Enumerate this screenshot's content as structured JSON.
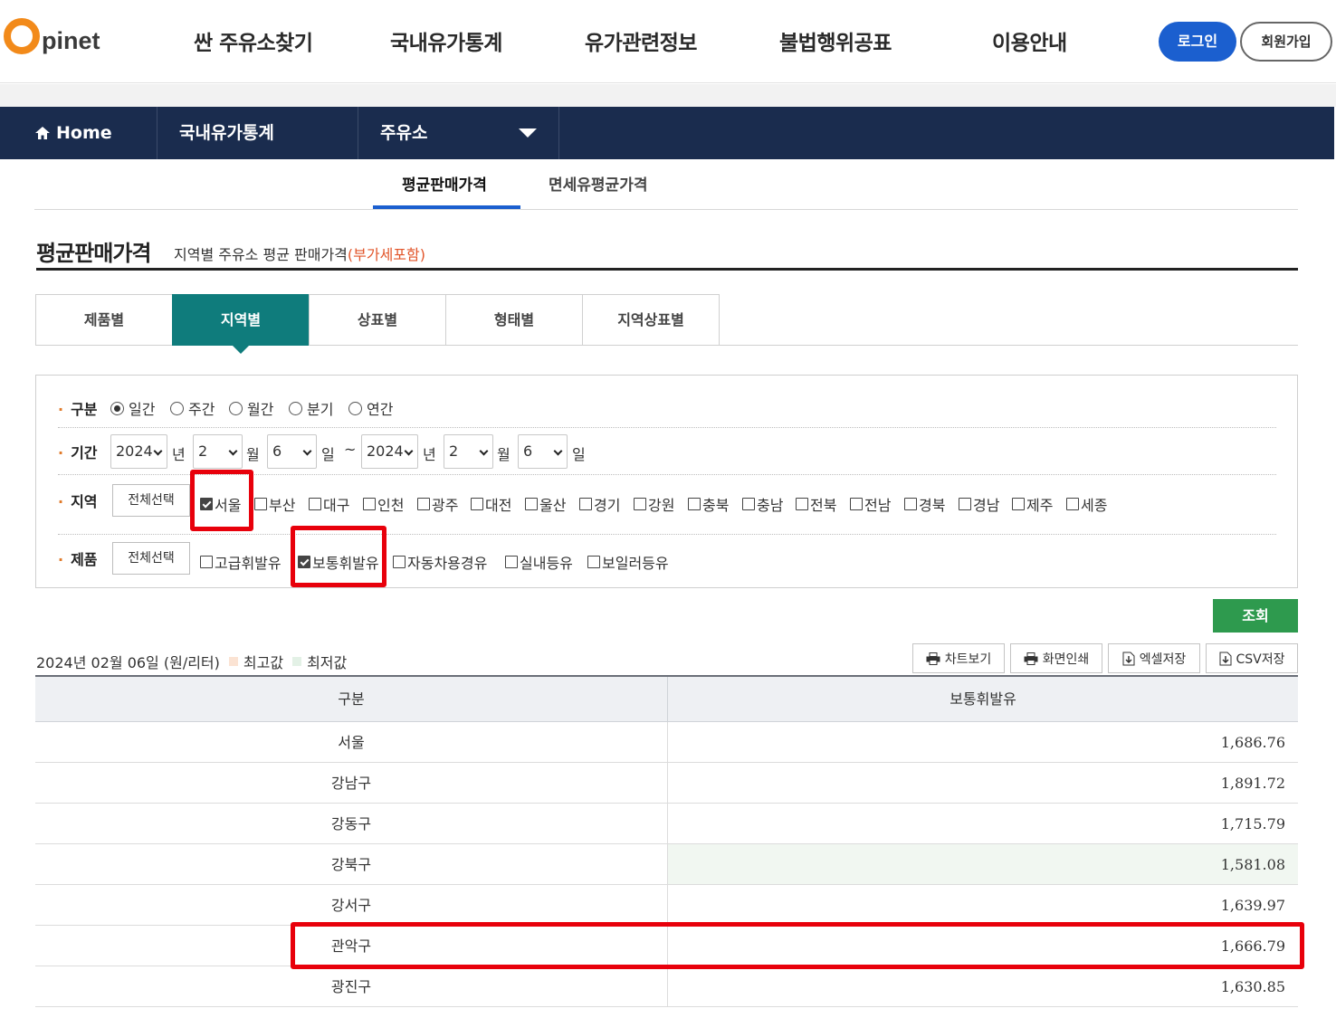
{
  "header": {
    "logo_o": "O",
    "logo_text": "pinet",
    "nav": [
      "싼 주유소찾기",
      "국내유가통계",
      "유가관련정보",
      "불법행위공표",
      "이용안내"
    ],
    "login": "로그인",
    "join": "회원가입"
  },
  "breadcrumb": {
    "home": "Home",
    "section": "국내유가통계",
    "current": "주유소"
  },
  "subtabs": [
    "평균판매가격",
    "면세유평균가격"
  ],
  "page": {
    "title": "평균판매가격",
    "subtitle": "지역별 주유소 평균 판매가격",
    "vat": "(부가세포함)"
  },
  "category_tabs": [
    "제품별",
    "지역별",
    "상표별",
    "형태별",
    "지역상표별"
  ],
  "filter": {
    "type_label": "구분",
    "types": [
      {
        "label": "일간",
        "checked": true
      },
      {
        "label": "주간",
        "checked": false
      },
      {
        "label": "월간",
        "checked": false
      },
      {
        "label": "분기",
        "checked": false
      },
      {
        "label": "연간",
        "checked": false
      }
    ],
    "period_label": "기간",
    "period": {
      "from_year": "2024",
      "from_month": "2",
      "from_day": "6",
      "to_year": "2024",
      "to_month": "2",
      "to_day": "6",
      "year_unit": "년",
      "month_unit": "월",
      "day_unit": "일",
      "tilde": "~"
    },
    "region_label": "지역",
    "select_all": "전체선택",
    "regions": [
      {
        "label": "서울",
        "checked": true
      },
      {
        "label": "부산",
        "checked": false
      },
      {
        "label": "대구",
        "checked": false
      },
      {
        "label": "인천",
        "checked": false
      },
      {
        "label": "광주",
        "checked": false
      },
      {
        "label": "대전",
        "checked": false
      },
      {
        "label": "울산",
        "checked": false
      },
      {
        "label": "경기",
        "checked": false
      },
      {
        "label": "강원",
        "checked": false
      },
      {
        "label": "충북",
        "checked": false
      },
      {
        "label": "충남",
        "checked": false
      },
      {
        "label": "전북",
        "checked": false
      },
      {
        "label": "전남",
        "checked": false
      },
      {
        "label": "경북",
        "checked": false
      },
      {
        "label": "경남",
        "checked": false
      },
      {
        "label": "제주",
        "checked": false
      },
      {
        "label": "세종",
        "checked": false
      }
    ],
    "product_label": "제품",
    "products": [
      {
        "label": "고급휘발유",
        "checked": false
      },
      {
        "label": "보통휘발유",
        "checked": true
      },
      {
        "label": "자동차용경유",
        "checked": false
      },
      {
        "label": "실내등유",
        "checked": false
      },
      {
        "label": "보일러등유",
        "checked": false
      }
    ],
    "search": "조회"
  },
  "result": {
    "date_text": "2024년 02월 06일 (원/리터)",
    "legend_high": "최고값",
    "legend_low": "최저값",
    "colors": {
      "high": "#fbe3d3",
      "low": "#e3f1e6"
    },
    "tools": [
      "차트보기",
      "화면인쇄",
      "엑셀저장",
      "CSV저장"
    ]
  },
  "table": {
    "headers": [
      "구분",
      "보통휘발유"
    ],
    "rows": [
      {
        "name": "서울",
        "value": "1,686.76"
      },
      {
        "name": "강남구",
        "value": "1,891.72"
      },
      {
        "name": "강동구",
        "value": "1,715.79"
      },
      {
        "name": "강북구",
        "value": "1,581.08",
        "lowest": true
      },
      {
        "name": "강서구",
        "value": "1,639.97"
      },
      {
        "name": "관악구",
        "value": "1,666.79"
      },
      {
        "name": "광진구",
        "value": "1,630.85"
      }
    ]
  }
}
